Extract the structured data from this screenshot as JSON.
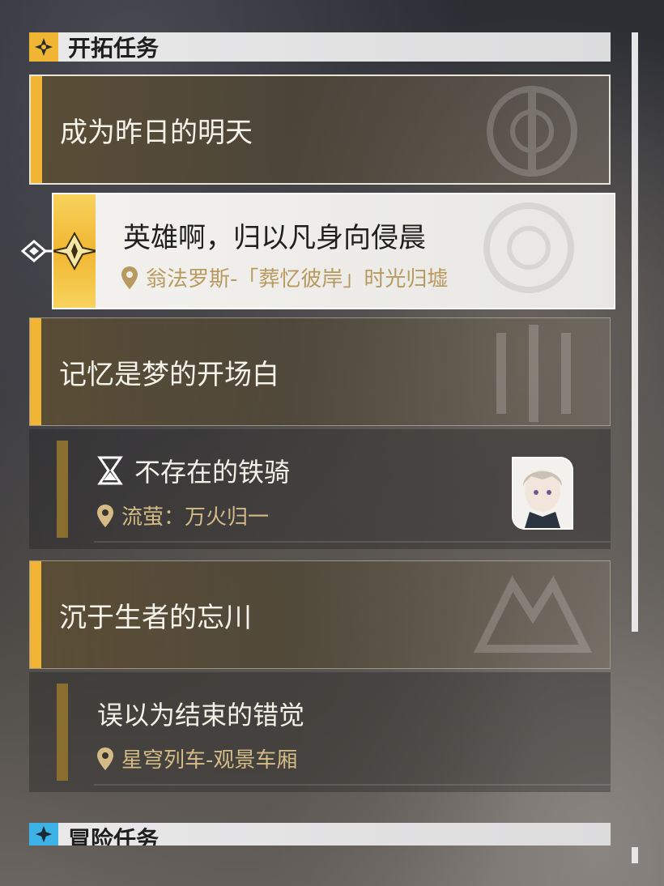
{
  "sections": {
    "trailblaze": {
      "title": "开拓任务"
    },
    "adventure": {
      "title": "冒险任务"
    }
  },
  "chapters": [
    {
      "title": "成为昨日的明天"
    },
    {
      "title": "记忆是梦的开场白"
    },
    {
      "title": "沉于生者的忘川"
    }
  ],
  "selected_quest": {
    "title": "英雄啊，归以凡身向侵晨",
    "location": "翁法罗斯-「葬忆彼岸」时光归墟"
  },
  "quests": [
    {
      "title": "不存在的铁骑",
      "location": "流萤：万火归一"
    },
    {
      "title": "误以为结束的错觉",
      "location": "星穹列车-观景车厢"
    }
  ],
  "colors": {
    "gold_accent": "#f2b435",
    "adventure_accent": "#3db2e6",
    "location_text": "#d4bb86"
  }
}
